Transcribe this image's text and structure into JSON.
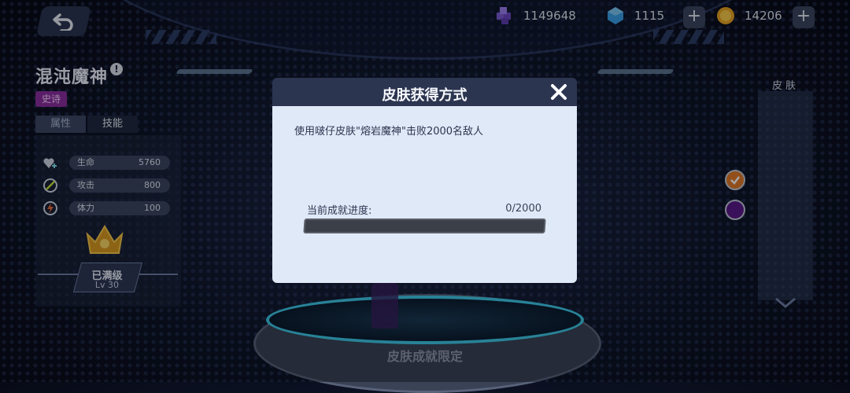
{
  "hero": {
    "name": "混沌魔神",
    "info_icon": "info-icon",
    "rarity": "史诗",
    "tabs": [
      "属性",
      "技能"
    ],
    "stats": [
      {
        "icon": "heart-plus-icon",
        "label": "生命",
        "value": "5760"
      },
      {
        "icon": "attack-icon",
        "label": "攻击",
        "value": "800"
      },
      {
        "icon": "lightning-icon",
        "label": "体力",
        "value": "100"
      }
    ],
    "level_status": "已满级",
    "level": "Lv 30"
  },
  "currencies": [
    {
      "icon": "purple-gem-icon",
      "value": "1149648"
    },
    {
      "icon": "blue-crystal-icon",
      "value": "1115"
    },
    {
      "icon": "gold-coin-icon",
      "value": "14206"
    }
  ],
  "skin_panel": {
    "header": "皮肤",
    "swatches": [
      "#e07a2a",
      "#5b1a8a"
    ]
  },
  "platform_label": "皮肤成就限定",
  "modal": {
    "title": "皮肤获得方式",
    "requirement": "使用啵仔皮肤\"熔岩魔神\"击败2000名敌人",
    "progress_label": "当前成就进度:",
    "progress_value": "0/2000",
    "progress_fraction": 0
  },
  "colors": {
    "rarity": "#8a2ea0",
    "modal_body": "#dfe9f7",
    "modal_header": "#2c3550",
    "platform_ring": "#3ec8e8"
  }
}
